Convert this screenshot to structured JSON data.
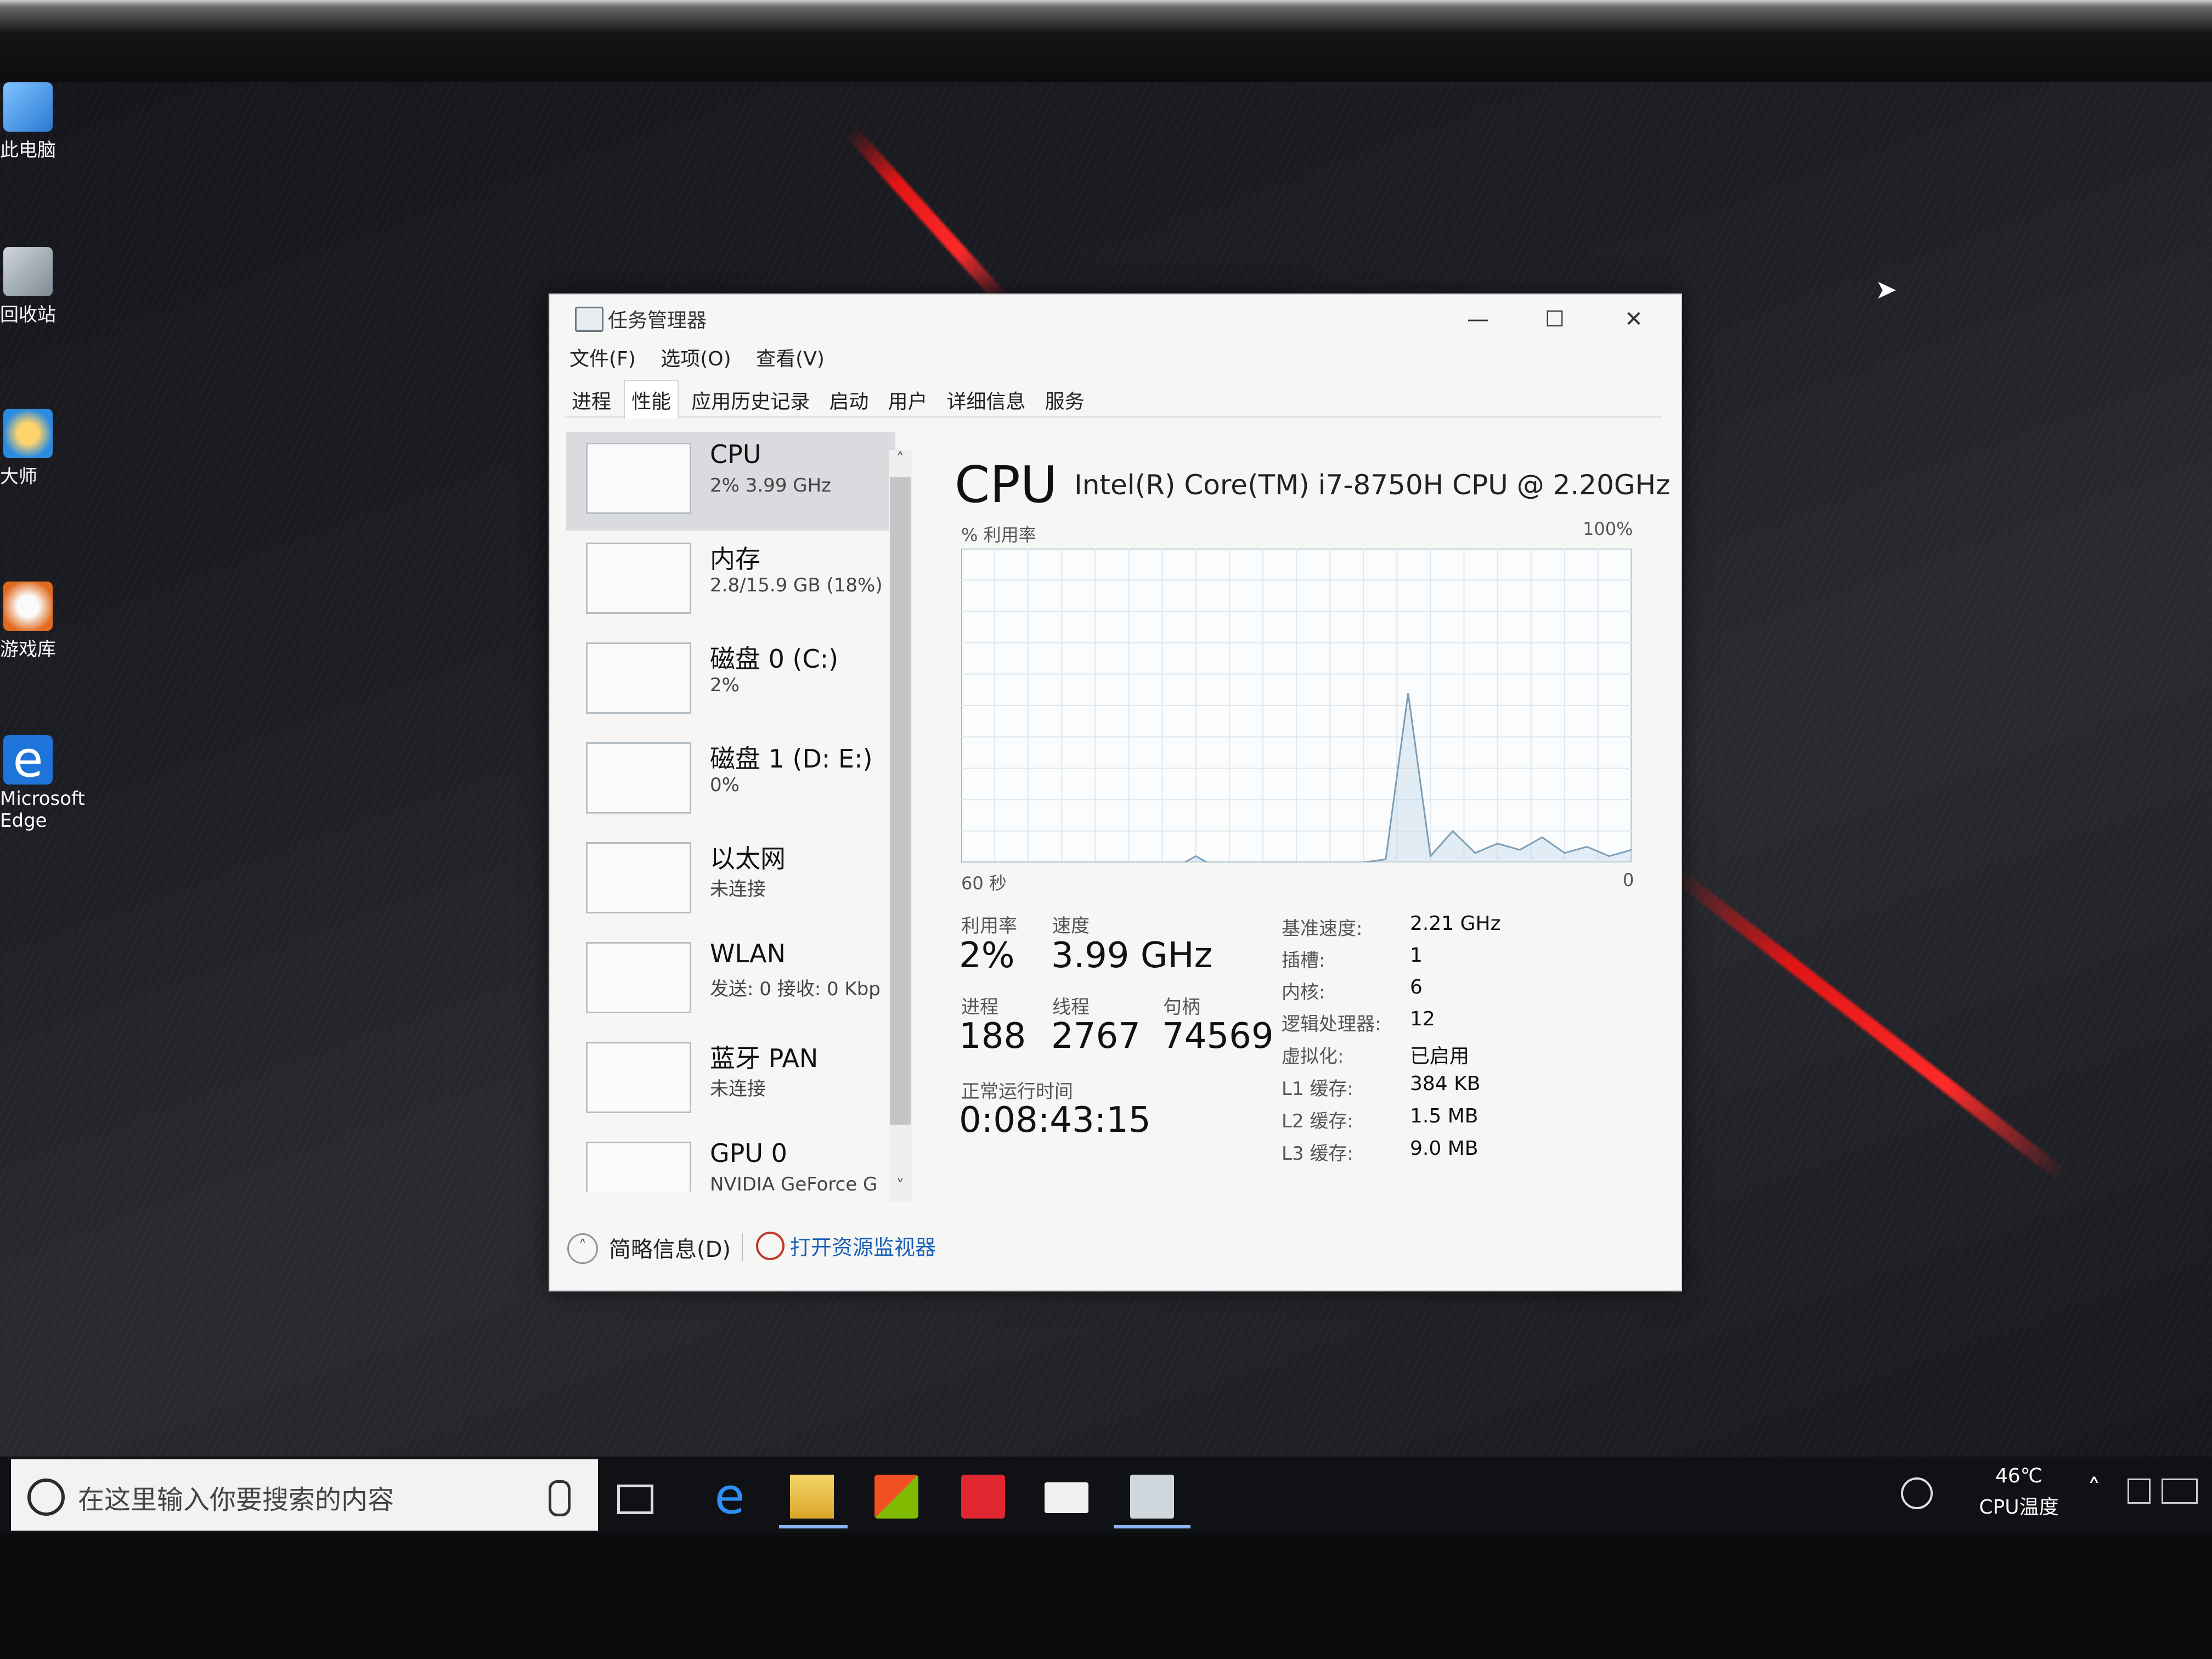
{
  "desktop": {
    "icons": [
      {
        "label": "此电脑"
      },
      {
        "label": "回收站"
      },
      {
        "label": "大师"
      },
      {
        "label": "游戏库"
      },
      {
        "label": "Microsoft Edge"
      }
    ]
  },
  "window": {
    "title": "任务管理器",
    "menu": [
      "文件(F)",
      "选项(O)",
      "查看(V)"
    ],
    "tabs": [
      "进程",
      "性能",
      "应用历史记录",
      "启动",
      "用户",
      "详细信息",
      "服务"
    ],
    "active_tab": "性能"
  },
  "sidebar": {
    "items": [
      {
        "name": "CPU",
        "sub": "2% 3.99 GHz"
      },
      {
        "name": "内存",
        "sub": "2.8/15.9 GB (18%)"
      },
      {
        "name": "磁盘 0 (C:)",
        "sub": "2%"
      },
      {
        "name": "磁盘 1 (D: E:)",
        "sub": "0%"
      },
      {
        "name": "以太网",
        "sub": "未连接"
      },
      {
        "name": "WLAN",
        "sub": "发送: 0 接收: 0 Kbp"
      },
      {
        "name": "蓝牙 PAN",
        "sub": "未连接"
      },
      {
        "name": "GPU 0",
        "sub": "NVIDIA GeForce G"
      }
    ]
  },
  "panel": {
    "title": "CPU",
    "model": "Intel(R) Core(TM) i7-8750H CPU @ 2.20GHz",
    "graph": {
      "y_label": "% 利用率",
      "y_max": "100%",
      "x_left": "60 秒",
      "x_right": "0"
    },
    "stats": {
      "utilization_label": "利用率",
      "utilization": "2%",
      "speed_label": "速度",
      "speed": "3.99 GHz",
      "processes_label": "进程",
      "processes": "188",
      "threads_label": "线程",
      "threads": "2767",
      "handles_label": "句柄",
      "handles": "74569",
      "uptime_label": "正常运行时间",
      "uptime": "0:08:43:15"
    },
    "details": [
      {
        "k": "基准速度:",
        "v": "2.21 GHz"
      },
      {
        "k": "插槽:",
        "v": "1"
      },
      {
        "k": "内核:",
        "v": "6"
      },
      {
        "k": "逻辑处理器:",
        "v": "12"
      },
      {
        "k": "虚拟化:",
        "v": "已启用"
      },
      {
        "k": "L1 缓存:",
        "v": "384 KB"
      },
      {
        "k": "L2 缓存:",
        "v": "1.5 MB"
      },
      {
        "k": "L3 缓存:",
        "v": "9.0 MB"
      }
    ]
  },
  "footer": {
    "fewer_details": "简略信息(D)",
    "open_monitor": "打开资源监视器"
  },
  "taskbar": {
    "search_placeholder": "在这里输入你要搜索的内容",
    "temp": "46℃",
    "temp_label": "CPU温度"
  },
  "chart_data": {
    "type": "line",
    "ylim": [
      0,
      100
    ],
    "x": [
      60,
      57,
      54,
      51,
      48,
      45,
      42,
      40,
      39,
      38,
      37,
      36,
      34,
      32,
      30,
      28,
      26,
      24,
      22,
      20,
      18,
      16,
      14,
      12,
      10,
      8,
      6,
      4,
      2,
      0
    ],
    "values": [
      0,
      0,
      0,
      0,
      0,
      0,
      0,
      0,
      2,
      0,
      0,
      0,
      0,
      0,
      0,
      0,
      0,
      0,
      1,
      54,
      2,
      10,
      3,
      6,
      4,
      8,
      3,
      5,
      2,
      4
    ]
  }
}
